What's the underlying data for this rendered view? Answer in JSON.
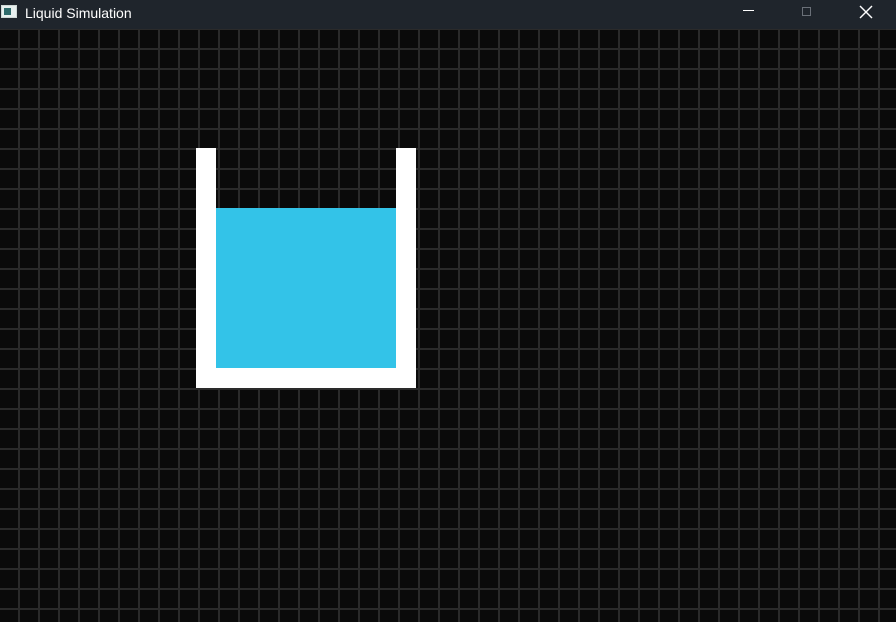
{
  "window": {
    "title": "Liquid Simulation"
  },
  "colors": {
    "titlebar": "#1f252c",
    "background": "#0a0a0a",
    "grid_line": "#2a2a2a",
    "container": "#ffffff",
    "liquid": "#33c3e8"
  },
  "icons": {
    "app": "app-window-icon",
    "minimize": "minimize-icon",
    "maximize": "maximize-icon",
    "close": "close-icon"
  }
}
